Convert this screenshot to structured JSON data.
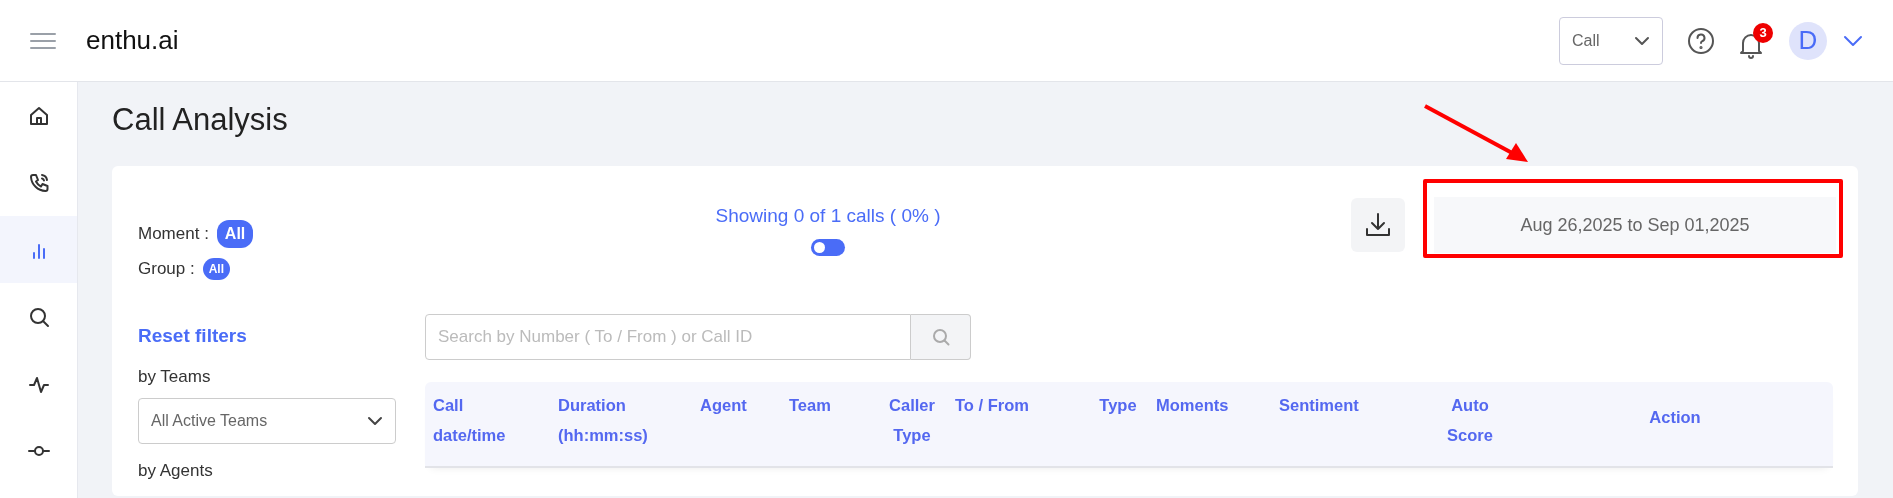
{
  "header": {
    "logo": "enthu.ai",
    "mode_select": {
      "value": "Call"
    },
    "notifications": {
      "count": "3"
    },
    "avatar": {
      "initial": "D"
    }
  },
  "sidebar": {
    "items": [
      {
        "kind": "home",
        "selected": false
      },
      {
        "kind": "phone",
        "selected": false
      },
      {
        "kind": "chart",
        "selected": true
      },
      {
        "kind": "search",
        "selected": false
      },
      {
        "kind": "pulse",
        "selected": false
      },
      {
        "kind": "commit",
        "selected": false
      }
    ]
  },
  "page": {
    "title": "Call Analysis"
  },
  "filters_summary": [
    {
      "label": "Moment :",
      "value": "All"
    },
    {
      "label": "Group :",
      "value": "All"
    }
  ],
  "showing": {
    "text": "Showing 0 of 1 calls ( 0% )",
    "toggle_on": false
  },
  "date_range": "Aug 26,2025 to Sep 01,2025",
  "reset_filters": "Reset filters",
  "filter_groups": [
    {
      "label": "by Teams",
      "select": "All Active Teams"
    },
    {
      "label": "by Agents"
    }
  ],
  "search": {
    "placeholder": "Search by Number ( To / From ) or Call ID"
  },
  "table": {
    "columns": [
      "Call\ndate/time",
      "Duration\n(hh:mm:ss)",
      "Agent",
      "Team",
      "Caller\nType",
      "To / From",
      "Type",
      "Moments",
      "Sentiment",
      "Auto\nScore",
      "Action"
    ]
  }
}
